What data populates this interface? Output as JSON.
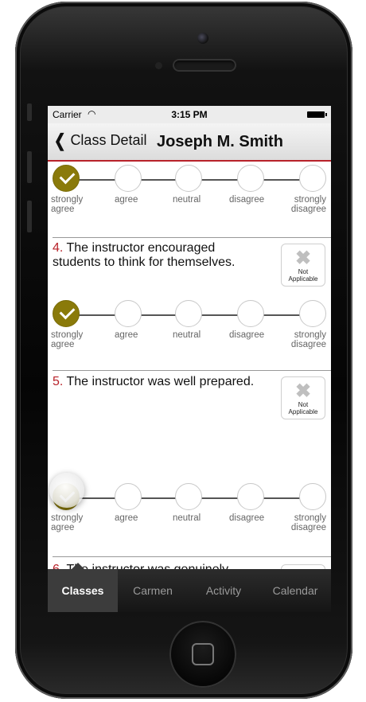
{
  "status_bar": {
    "carrier": "Carrier",
    "wifi_icon": "wifi-icon",
    "time": "3:15 PM",
    "battery_icon": "battery-icon"
  },
  "navbar": {
    "back_label": "Class Detail",
    "back_icon": "chevron-left-icon",
    "title": "Joseph M. Smith",
    "accent": "#b8222a"
  },
  "scale_options": [
    "strongly agree",
    "agree",
    "neutral",
    "disagree",
    "strongly disagree"
  ],
  "scale_labels": {
    "strongly_agree": [
      "strongly",
      "agree"
    ],
    "agree": "agree",
    "neutral": "neutral",
    "disagree": "disagree",
    "strongly_disagree": [
      "strongly",
      "disagree"
    ]
  },
  "selected_color": "#8a7a0a",
  "questions": [
    {
      "number": "4.",
      "text": "The instructor encouraged students to think for themselves.",
      "selected": "strongly agree"
    },
    {
      "number": "5.",
      "text": "The instructor was well prepared.",
      "selected": "strongly agree"
    },
    {
      "number": "6.",
      "text": "The instructor was genuinely interested in helping students.",
      "selected": null
    }
  ],
  "previous_question_selected": "strongly agree",
  "not_applicable": {
    "line1": "Not",
    "line2": "Applicable",
    "icon": "close-icon"
  },
  "tabs": [
    {
      "label": "Classes",
      "active": true
    },
    {
      "label": "Carmen",
      "active": false
    },
    {
      "label": "Activity",
      "active": false
    },
    {
      "label": "Calendar",
      "active": false
    }
  ]
}
